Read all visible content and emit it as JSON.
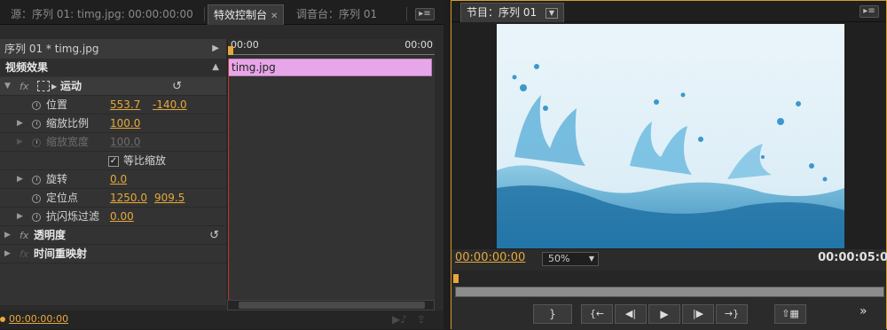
{
  "left": {
    "tabs": [
      {
        "label": "源：序列 01: timg.jpg: 00:00:00:00"
      },
      {
        "label": "特效控制台"
      },
      {
        "label": "调音台：序列 01"
      }
    ],
    "sequence_label": "序列 01 * timg.jpg",
    "timeline": {
      "start": "00:00",
      "end": "00:00",
      "clip": "timg.jpg"
    },
    "section_title": "视频效果",
    "effects": {
      "motion": {
        "label": "运动"
      },
      "position": {
        "label": "位置",
        "x": "553.7",
        "y": "-140.0"
      },
      "scale": {
        "label": "缩放比例",
        "value": "100.0"
      },
      "scale_width": {
        "label": "缩放宽度",
        "value": "100.0"
      },
      "uniform_scale": {
        "label": "等比缩放",
        "checked": true
      },
      "rotation": {
        "label": "旋转",
        "value": "0.0"
      },
      "anchor": {
        "label": "定位点",
        "x": "1250.0",
        "y": "909.5"
      },
      "antiflicker": {
        "label": "抗闪烁过滤",
        "value": "0.00"
      },
      "opacity": {
        "label": "透明度"
      },
      "time_remap": {
        "label": "时间重映射"
      }
    },
    "footer_timecode": "00:00:00:00"
  },
  "right": {
    "tab": "节目：序列 01",
    "timecode_current": "00:00:00:00",
    "zoom": "50%",
    "timecode_end": "00:00:05:0",
    "transport": [
      "mark-out",
      "go-to-in",
      "step-back",
      "play",
      "step-forward",
      "go-to-out",
      "lift"
    ],
    "more": "»"
  },
  "colors": {
    "accent": "#e7a93a",
    "clip": "#e7a6e8",
    "playhead": "#c0392b",
    "focus_border": "#d89a2c"
  }
}
